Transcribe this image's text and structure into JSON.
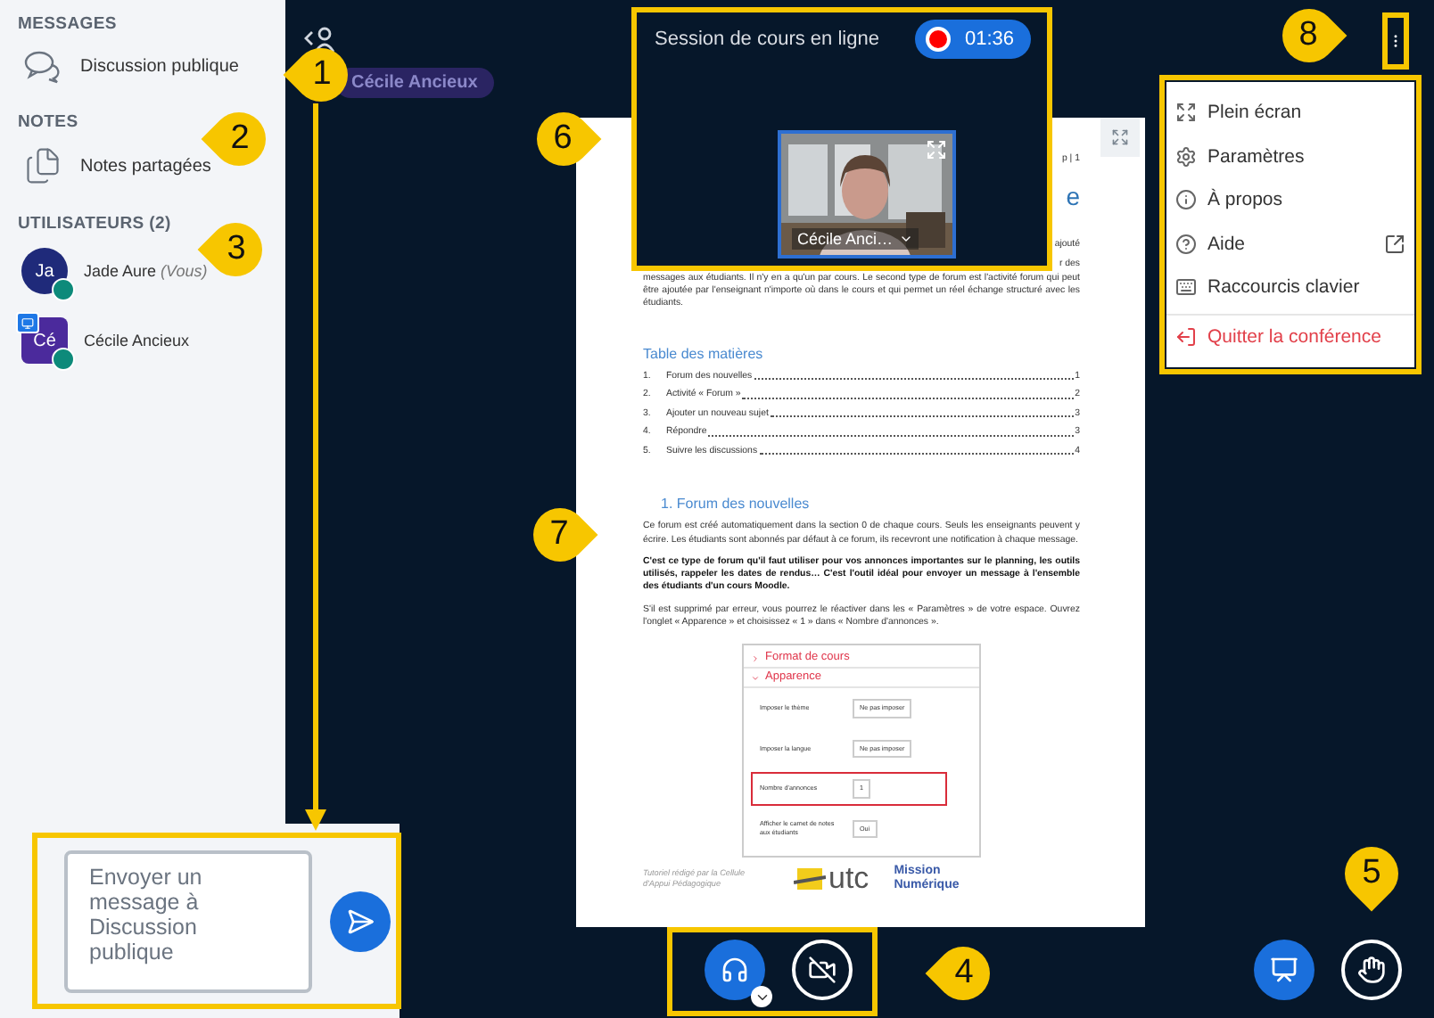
{
  "sidebar": {
    "messages_heading": "MESSAGES",
    "chat_item": "Discussion publique",
    "notes_heading": "NOTES",
    "notes_item": "Notes partagées",
    "users_heading": "UTILISATEURS (2)",
    "users": [
      {
        "initials": "Ja",
        "name": "Jade Aure",
        "suffix": "(Vous)",
        "presenter": false,
        "color": "#1f2a7a"
      },
      {
        "initials": "Cé",
        "name": "Cécile Ancieux",
        "presenter": true,
        "color": "#4b2a9c"
      }
    ]
  },
  "presenter_tag": "Cécile Ancieux",
  "session": {
    "title": "Session de cours en ligne",
    "recording": true,
    "time": "01:36"
  },
  "video": {
    "name": "Cécile Anci…"
  },
  "document": {
    "header_fragment": "p | 1",
    "title_fragment": "e",
    "intro_fragments": [
      "ajouté",
      "r des"
    ],
    "intro": "messages aux étudiants. Il n'y en a qu'un par cours. Le second type de forum est l'activité forum qui peut être ajoutée par l'enseignant n'importe où dans le cours et qui permet un réel échange structuré avec les étudiants.",
    "toc_title": "Table des matières",
    "toc": [
      {
        "number": "1.",
        "label": "Forum des nouvelles",
        "page": "1"
      },
      {
        "number": "2.",
        "label": "Activité « Forum »",
        "page": "2"
      },
      {
        "number": "3.",
        "label": "Ajouter un nouveau sujet",
        "page": "3"
      },
      {
        "number": "4.",
        "label": "Répondre",
        "page": "3"
      },
      {
        "number": "5.",
        "label": "Suivre les discussions",
        "page": "4"
      }
    ],
    "section_title": "1.  Forum des nouvelles",
    "paragraphs": [
      {
        "kind": "normal",
        "text": "Ce forum est créé automatiquement dans la section 0 de chaque cours. Seuls les enseignants peuvent y écrire.  Les étudiants sont abonnés par défaut à ce forum, ils recevront une notification à chaque message."
      },
      {
        "kind": "bold",
        "text": "C'est ce type de forum qu'il faut utiliser pour vos annonces importantes sur le planning, les outils utilisés, rappeler les dates de rendus… C'est l'outil idéal pour envoyer un message à l'ensemble des étudiants d'un cours Moodle."
      },
      {
        "kind": "normal",
        "text": "S'il est supprimé par erreur, vous pourrez le réactiver dans les « Paramètres » de votre espace. Ouvrez l'onglet « Apparence » et choisissez « 1 » dans « Nombre d'annonces »."
      }
    ],
    "form": {
      "sections": [
        {
          "label": "Format de cours",
          "expanded": false
        },
        {
          "label": "Apparence",
          "expanded": true
        }
      ],
      "rows": [
        {
          "label": "Imposer le thème",
          "value": "Ne pas imposer",
          "highlighted": false
        },
        {
          "label": "Imposer la langue",
          "value": "Ne pas imposer",
          "highlighted": false
        },
        {
          "label": "Nombre d'annonces",
          "value": "1",
          "highlighted": true
        },
        {
          "label": "Afficher le carnet de notes aux étudiants",
          "value": "Oui",
          "highlighted": false
        }
      ]
    },
    "footer": {
      "credit": "Tutoriel rédigé par la Cellule d'Appui Pédagogique",
      "logos": [
        "utc",
        "Mission Numérique"
      ]
    }
  },
  "menu": [
    {
      "kind": "fullscreen",
      "label": "Plein écran"
    },
    {
      "kind": "settings",
      "label": "Paramètres"
    },
    {
      "kind": "about",
      "label": "À propos"
    },
    {
      "kind": "help",
      "label": "Aide"
    },
    {
      "kind": "keyboard",
      "label": "Raccourcis clavier"
    },
    {
      "kind": "leave",
      "label": "Quitter la conférence"
    }
  ],
  "chat": {
    "placeholder": "Envoyer un message à Discussion publique"
  },
  "controls": {
    "audio_joined": true,
    "camera_on": false
  },
  "callouts": [
    {
      "number": "1"
    },
    {
      "number": "2"
    },
    {
      "number": "3"
    },
    {
      "number": "4"
    },
    {
      "number": "5"
    },
    {
      "number": "6"
    },
    {
      "number": "7"
    },
    {
      "number": "8"
    }
  ]
}
